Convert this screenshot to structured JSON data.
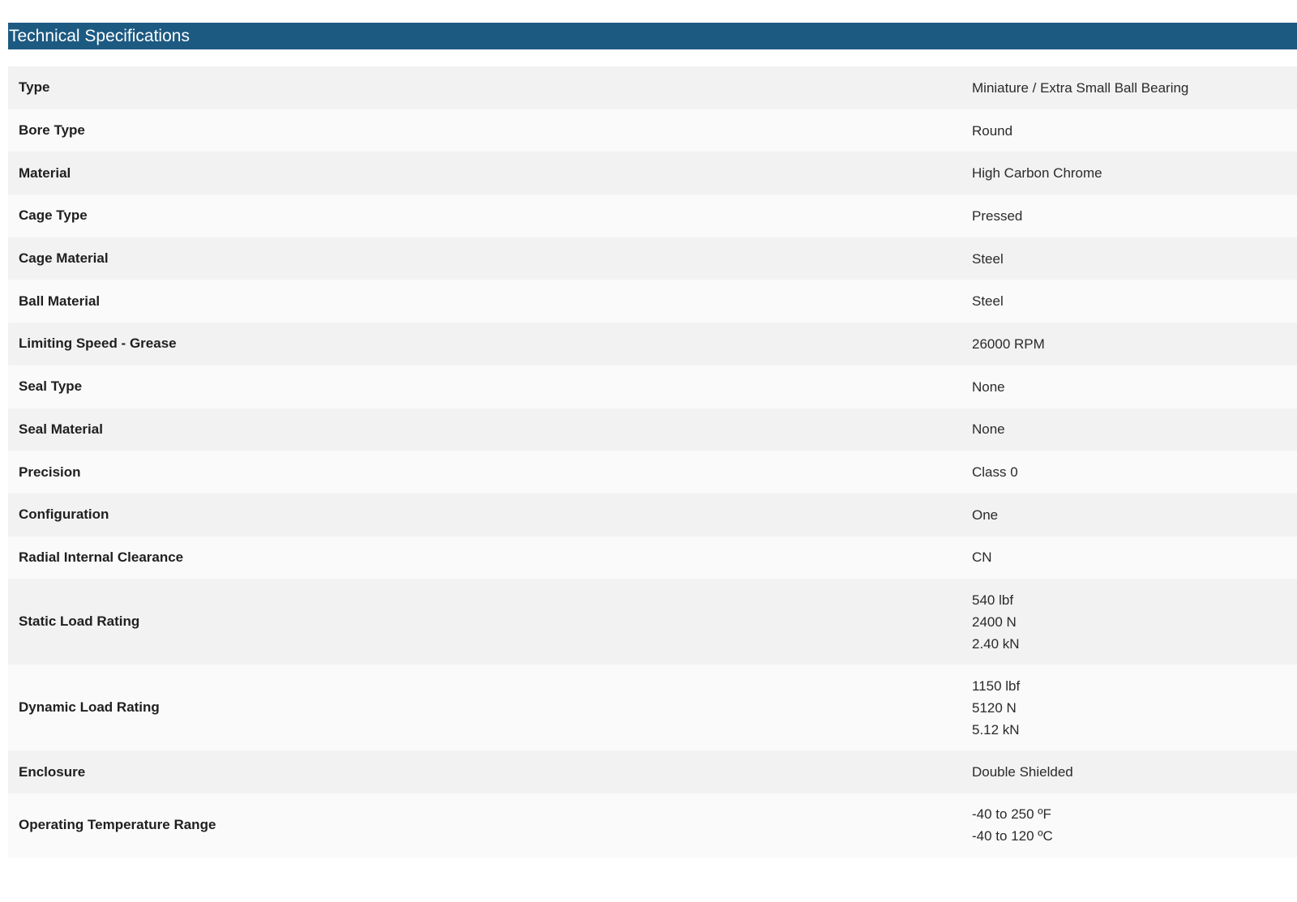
{
  "header": {
    "title": "Technical Specifications"
  },
  "specs": [
    {
      "label": "Type",
      "values": [
        "Miniature / Extra Small Ball Bearing"
      ]
    },
    {
      "label": "Bore Type",
      "values": [
        "Round"
      ]
    },
    {
      "label": "Material",
      "values": [
        "High Carbon Chrome"
      ]
    },
    {
      "label": "Cage Type",
      "values": [
        "Pressed"
      ]
    },
    {
      "label": "Cage Material",
      "values": [
        "Steel"
      ]
    },
    {
      "label": "Ball Material",
      "values": [
        "Steel"
      ]
    },
    {
      "label": "Limiting Speed - Grease",
      "values": [
        "26000 RPM"
      ]
    },
    {
      "label": "Seal Type",
      "values": [
        "None"
      ]
    },
    {
      "label": "Seal Material",
      "values": [
        "None"
      ]
    },
    {
      "label": "Precision",
      "values": [
        "Class 0"
      ]
    },
    {
      "label": "Configuration",
      "values": [
        "One"
      ]
    },
    {
      "label": "Radial Internal Clearance",
      "values": [
        "CN"
      ]
    },
    {
      "label": "Static Load Rating",
      "values": [
        "540 lbf",
        "2400 N",
        "2.40 kN"
      ]
    },
    {
      "label": "Dynamic Load Rating",
      "values": [
        "1150 lbf",
        "5120 N",
        "5.12 kN"
      ]
    },
    {
      "label": "Enclosure",
      "values": [
        "Double Shielded"
      ]
    },
    {
      "label": "Operating Temperature Range",
      "values": [
        "-40 to 250 ºF",
        "-40 to 120 ºC"
      ]
    }
  ],
  "colors": {
    "header_background": "#1d5a82",
    "header_text": "#ffffff",
    "row_odd": "#f2f2f2",
    "row_even": "#fafafa"
  }
}
